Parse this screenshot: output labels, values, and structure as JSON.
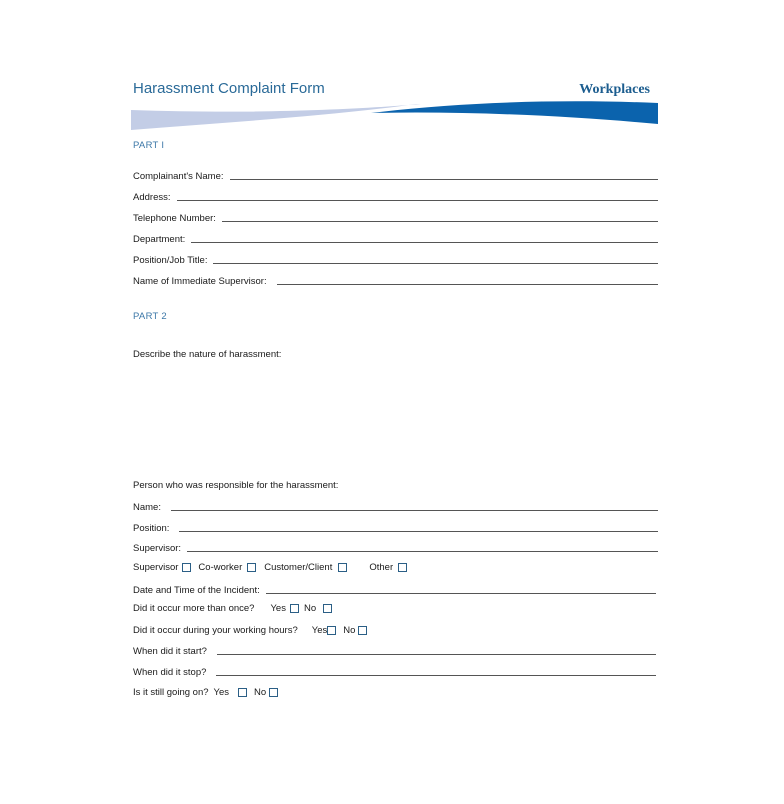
{
  "header": {
    "title": "Harassment Complaint Form",
    "brand": "Workplaces",
    "colors": {
      "title": "#2a6a98",
      "brand": "#1c5d8f",
      "swoosh_light": "#c3cde6",
      "swoosh_dark": "#0b63ad"
    }
  },
  "part1": {
    "heading": "PART I",
    "fields": [
      {
        "label": "Complainant's Name:",
        "value": ""
      },
      {
        "label": "Address:",
        "value": ""
      },
      {
        "label": "Telephone Number:",
        "value": ""
      },
      {
        "label": "Department:",
        "value": ""
      },
      {
        "label": "Position/Job Title:",
        "value": ""
      },
      {
        "label": "Name of Immediate Supervisor:",
        "value": ""
      }
    ]
  },
  "part2": {
    "heading": "PART 2",
    "describe_label": "Describe the nature of harassment:",
    "responsible_label": "Person who was responsible for the harassment:",
    "responsible_fields": [
      {
        "label": "Name:",
        "value": ""
      },
      {
        "label": "Position:",
        "value": ""
      },
      {
        "label": "Supervisor:",
        "value": ""
      }
    ],
    "relationship_options": [
      {
        "label": "Supervisor",
        "checked": false
      },
      {
        "label": "Co-worker",
        "checked": false
      },
      {
        "label": "Customer/Client",
        "checked": false
      },
      {
        "label": "Other",
        "checked": false
      }
    ],
    "incident_datetime_label": "Date and Time of the Incident:",
    "more_than_once": {
      "question": "Did it occur more than once?",
      "yes": "Yes",
      "no": "No"
    },
    "working_hours": {
      "question": "Did it occur during your working hours?",
      "yes": "Yes",
      "no": "No"
    },
    "start_label": "When did it start?",
    "stop_label": "When did it stop?",
    "still_going": {
      "question": "Is it still going on?",
      "yes": "Yes",
      "no": "No"
    }
  }
}
